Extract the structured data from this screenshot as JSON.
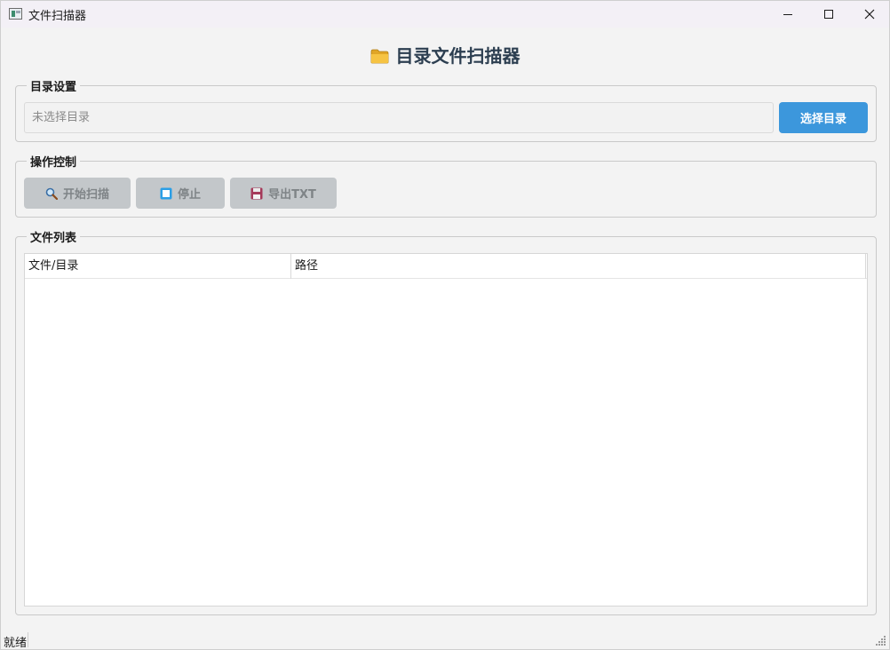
{
  "window": {
    "title": "文件扫描器",
    "controls": {
      "minimize": "minimize-icon",
      "maximize": "maximize-icon",
      "close": "close-icon"
    }
  },
  "heading": {
    "icon": "folder-icon",
    "text": "目录文件扫描器"
  },
  "directory_group": {
    "legend": "目录设置",
    "input_value": "",
    "input_placeholder": "未选择目录",
    "choose_button": "选择目录",
    "accent_color": "#3c97dc"
  },
  "operations_group": {
    "legend": "操作控制",
    "buttons": [
      {
        "icon": "magnifier-icon",
        "label": "开始扫描",
        "enabled": false
      },
      {
        "icon": "stop-icon",
        "label": "停止",
        "enabled": false
      },
      {
        "icon": "floppy-disk-icon",
        "label": "导出TXT",
        "enabled": false
      }
    ]
  },
  "files_group": {
    "legend": "文件列表",
    "columns": [
      "文件/目录",
      "路径"
    ],
    "rows": []
  },
  "status": {
    "text": "就绪"
  }
}
